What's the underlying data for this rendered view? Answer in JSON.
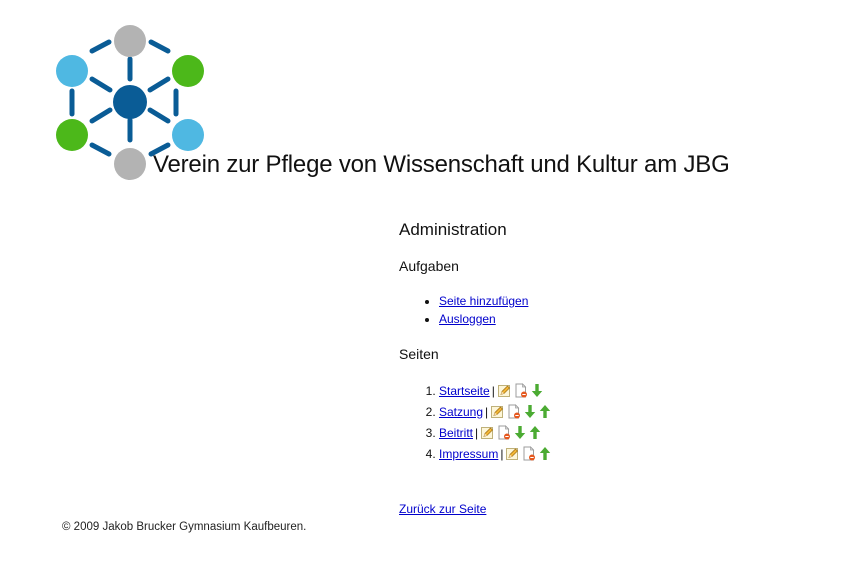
{
  "header": {
    "title": "Verein zur Pflege von Wissenschaft und Kultur am JBG"
  },
  "logo": {
    "colors": {
      "navy": "#0a5c96",
      "gray": "#b3b3b3",
      "light_blue": "#4fb8e2",
      "green": "#4cb81a"
    }
  },
  "admin": {
    "title": "Administration",
    "tasks": {
      "heading": "Aufgaben",
      "items": [
        {
          "label": "Seite hinzufügen"
        },
        {
          "label": "Ausloggen"
        }
      ]
    },
    "pages": {
      "heading": "Seiten",
      "items": [
        {
          "number": "1.",
          "label": "Startseite",
          "separator": "|",
          "icons": [
            "edit-icon",
            "delete-page-icon",
            "move-down-icon"
          ]
        },
        {
          "number": "2.",
          "label": "Satzung",
          "separator": "|",
          "icons": [
            "edit-icon",
            "delete-page-icon",
            "move-down-icon",
            "move-up-icon"
          ]
        },
        {
          "number": "3.",
          "label": "Beitritt",
          "separator": "|",
          "icons": [
            "edit-icon",
            "delete-page-icon",
            "move-down-icon",
            "move-up-icon"
          ]
        },
        {
          "number": "4.",
          "label": "Impressum",
          "separator": "|",
          "icons": [
            "edit-icon",
            "delete-page-icon",
            "move-up-icon"
          ]
        }
      ]
    },
    "back_link": "Zurück zur Seite"
  },
  "footer": {
    "text": "© 2009 Jakob Brucker Gymnasium Kaufbeuren."
  }
}
